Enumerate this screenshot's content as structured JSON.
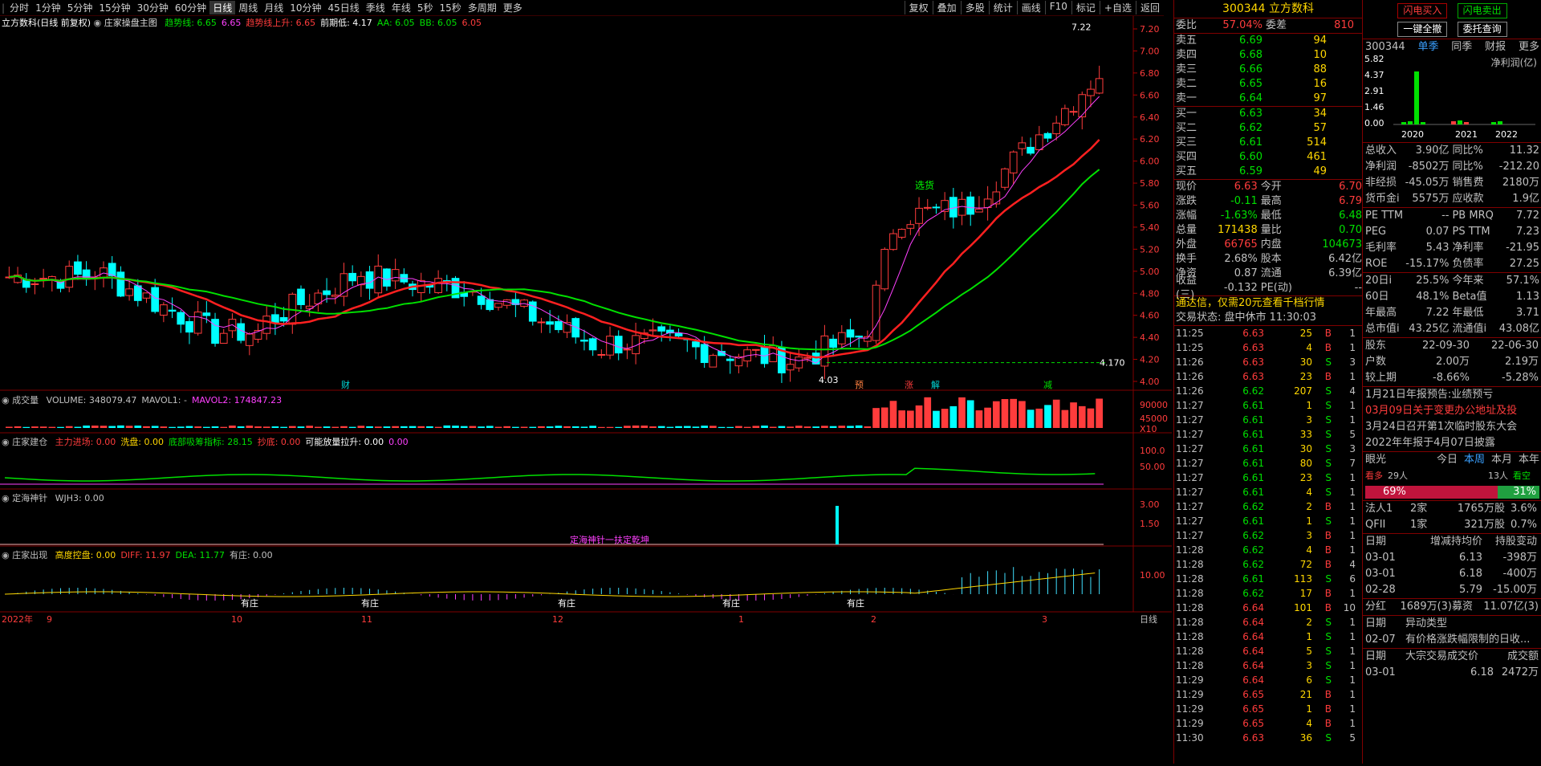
{
  "toolbar": {
    "periods": [
      "分时",
      "1分钟",
      "5分钟",
      "15分钟",
      "30分钟",
      "60分钟",
      "日线",
      "周线",
      "月线",
      "10分钟",
      "45日线",
      "季线",
      "年线",
      "5秒",
      "15秒",
      "多周期",
      "更多"
    ],
    "active": "日线",
    "right_buttons": [
      "复权",
      "叠加",
      "多股",
      "统计",
      "画线",
      "F10",
      "标记",
      "+自选",
      "返回"
    ]
  },
  "main_title": {
    "name": "立方数科(日线 前复权)",
    "indicator": "庄家操盘主图",
    "items": [
      {
        "t": "趋势线: 6.65",
        "c": "#00e000"
      },
      {
        "t": "6.65",
        "c": "#ff40ff"
      },
      {
        "t": "趋势线上升: 6.65",
        "c": "#ff3c3c"
      },
      {
        "t": "前期低: 4.17",
        "c": "#ffffff"
      },
      {
        "t": "AA: 6.05",
        "c": "#00e000"
      },
      {
        "t": "BB: 6.05",
        "c": "#00e000"
      },
      {
        "t": "6.05",
        "c": "#ff3c3c"
      }
    ]
  },
  "price_axis": [
    "7.20",
    "7.00",
    "6.80",
    "6.60",
    "6.40",
    "6.20",
    "6.00",
    "5.80",
    "5.60",
    "5.40",
    "5.20",
    "5.00",
    "4.80",
    "4.60",
    "4.40",
    "4.20",
    "4.00"
  ],
  "annotations": {
    "high": "7.22",
    "low": "4.03",
    "level": "4.170",
    "tag_xuanzhong": "选货",
    "markers": [
      "财",
      "预",
      "涨",
      "解",
      "减"
    ]
  },
  "volume_panel": {
    "title": "成交量",
    "items": [
      {
        "t": "VOLUME: 348079.47",
        "c": "#c0c0c0"
      },
      {
        "t": "MAVOL1: -",
        "c": "#c0c0c0"
      },
      {
        "t": "MAVOL2: 174847.23",
        "c": "#ff40ff"
      }
    ],
    "axis": [
      "90000",
      "45000",
      "X10"
    ]
  },
  "jiancang_panel": {
    "title": "庄家建仓",
    "items": [
      {
        "t": "主力进场: 0.00",
        "c": "#ff3c3c"
      },
      {
        "t": "洗盘: 0.00",
        "c": "#ffd700"
      },
      {
        "t": "底部吸筹指标: 28.15",
        "c": "#00e000"
      },
      {
        "t": "抄底: 0.00",
        "c": "#ff3c3c"
      },
      {
        "t": "可能放量拉升: 0.00",
        "c": "#ffffff"
      },
      {
        "t": "0.00",
        "c": "#ff40ff"
      }
    ],
    "axis": [
      "100.0",
      "50.00"
    ]
  },
  "dinghai_panel": {
    "title": "定海神针",
    "items": [
      {
        "t": "WJH3: 0.00",
        "c": "#c0c0c0"
      }
    ],
    "axis": [
      "3.00",
      "1.50"
    ],
    "caption": "定海神针一扶定乾坤"
  },
  "chuxian_panel": {
    "title": "庄家出现",
    "items": [
      {
        "t": "高度控盘: 0.00",
        "c": "#ffd700"
      },
      {
        "t": "DIFF: 11.97",
        "c": "#ff3c3c"
      },
      {
        "t": "DEA: 11.77",
        "c": "#00e000"
      },
      {
        "t": "有庄: 0.00",
        "c": "#c0c0c0"
      }
    ],
    "axis": [
      "10.00"
    ],
    "labels": [
      "有庄",
      "有庄",
      "有庄",
      "有庄",
      "有庄"
    ]
  },
  "date_axis": [
    "2022年",
    "9",
    "10",
    "11",
    "12",
    "1",
    "2",
    "3"
  ],
  "date_period": "日线",
  "quote": {
    "code": "300344",
    "name": "立方数科",
    "weibi_label": "委比",
    "weibi": "57.04%",
    "weicha_label": "委差",
    "weicha": "810",
    "asks": [
      {
        "l": "卖五",
        "p": "6.69",
        "v": "94"
      },
      {
        "l": "卖四",
        "p": "6.68",
        "v": "10"
      },
      {
        "l": "卖三",
        "p": "6.66",
        "v": "88"
      },
      {
        "l": "卖二",
        "p": "6.65",
        "v": "16"
      },
      {
        "l": "卖一",
        "p": "6.64",
        "v": "97"
      }
    ],
    "bids": [
      {
        "l": "买一",
        "p": "6.63",
        "v": "34"
      },
      {
        "l": "买二",
        "p": "6.62",
        "v": "57"
      },
      {
        "l": "买三",
        "p": "6.61",
        "v": "514"
      },
      {
        "l": "买四",
        "p": "6.60",
        "v": "461"
      },
      {
        "l": "买五",
        "p": "6.59",
        "v": "49"
      }
    ],
    "stats": [
      {
        "l1": "现价",
        "v1": "6.63",
        "c1": "#ff3c3c",
        "l2": "今开",
        "v2": "6.70",
        "c2": "#ff3c3c"
      },
      {
        "l1": "涨跌",
        "v1": "-0.11",
        "c1": "#00e000",
        "l2": "最高",
        "v2": "6.79",
        "c2": "#ff3c3c"
      },
      {
        "l1": "涨幅",
        "v1": "-1.63%",
        "c1": "#00e000",
        "l2": "最低",
        "v2": "6.48",
        "c2": "#00e000"
      },
      {
        "l1": "总量",
        "v1": "171438",
        "c1": "#ffd700",
        "l2": "量比",
        "v2": "0.70",
        "c2": "#00e000"
      },
      {
        "l1": "外盘",
        "v1": "66765",
        "c1": "#ff3c3c",
        "l2": "内盘",
        "v2": "104673",
        "c2": "#00e000"
      },
      {
        "l1": "换手",
        "v1": "2.68%",
        "c1": "#c0c0c0",
        "l2": "股本",
        "v2": "6.42亿",
        "c2": "#c0c0c0"
      },
      {
        "l1": "净资",
        "v1": "0.87",
        "c1": "#c0c0c0",
        "l2": "流通",
        "v2": "6.39亿",
        "c2": "#c0c0c0"
      },
      {
        "l1": "收益(三)",
        "v1": "-0.132",
        "c1": "#c0c0c0",
        "l2": "PE(动)",
        "v2": "--",
        "c2": "#c0c0c0"
      }
    ],
    "promo": "通达信，仅需20元查看千档行情",
    "trade_state": "交易状态: 盘中休市 11:30:03",
    "ticks": [
      [
        "11:25",
        "6.63",
        "25",
        "B",
        "1"
      ],
      [
        "11:25",
        "6.63",
        "4",
        "B",
        "1"
      ],
      [
        "11:26",
        "6.63",
        "30",
        "S",
        "3"
      ],
      [
        "11:26",
        "6.63",
        "23",
        "B",
        "1"
      ],
      [
        "11:26",
        "6.62",
        "207",
        "S",
        "4"
      ],
      [
        "11:27",
        "6.61",
        "1",
        "S",
        "1"
      ],
      [
        "11:27",
        "6.61",
        "3",
        "S",
        "1"
      ],
      [
        "11:27",
        "6.61",
        "33",
        "S",
        "5"
      ],
      [
        "11:27",
        "6.61",
        "30",
        "S",
        "3"
      ],
      [
        "11:27",
        "6.61",
        "80",
        "S",
        "7"
      ],
      [
        "11:27",
        "6.61",
        "23",
        "S",
        "1"
      ],
      [
        "11:27",
        "6.61",
        "4",
        "S",
        "1"
      ],
      [
        "11:27",
        "6.62",
        "2",
        "B",
        "1"
      ],
      [
        "11:27",
        "6.61",
        "1",
        "S",
        "1"
      ],
      [
        "11:27",
        "6.62",
        "3",
        "B",
        "1"
      ],
      [
        "11:28",
        "6.62",
        "4",
        "B",
        "1"
      ],
      [
        "11:28",
        "6.62",
        "72",
        "B",
        "4"
      ],
      [
        "11:28",
        "6.61",
        "113",
        "S",
        "6"
      ],
      [
        "11:28",
        "6.62",
        "17",
        "B",
        "1"
      ],
      [
        "11:28",
        "6.64",
        "101",
        "B",
        "10"
      ],
      [
        "11:28",
        "6.64",
        "2",
        "S",
        "1"
      ],
      [
        "11:28",
        "6.64",
        "1",
        "S",
        "1"
      ],
      [
        "11:28",
        "6.64",
        "5",
        "S",
        "1"
      ],
      [
        "11:28",
        "6.64",
        "3",
        "S",
        "1"
      ],
      [
        "11:29",
        "6.64",
        "6",
        "S",
        "1"
      ],
      [
        "11:29",
        "6.65",
        "21",
        "B",
        "1"
      ],
      [
        "11:29",
        "6.65",
        "1",
        "B",
        "1"
      ],
      [
        "11:29",
        "6.65",
        "4",
        "B",
        "1"
      ],
      [
        "11:30",
        "6.63",
        "36",
        "S",
        "5"
      ]
    ]
  },
  "fin": {
    "btn_flash_buy": "闪电买入",
    "btn_flash_sell": "闪电卖出",
    "btn_cancel_all": "一键全撤",
    "btn_entrust": "委托查询",
    "tabs": [
      "300344",
      "单季",
      "同季",
      "财报",
      "更多"
    ],
    "chart_title": "净利润(亿)",
    "chart_axis": [
      "5.82",
      "4.37",
      "2.91",
      "1.46",
      "0.00"
    ],
    "chart_years": [
      "2020",
      "2021",
      "2022"
    ],
    "rows1": [
      [
        "总收入",
        "3.90亿",
        "同比%",
        "11.32"
      ],
      [
        "净利润",
        "-8502万",
        "同比%",
        "-212.20"
      ],
      [
        "非经损",
        "-45.05万",
        "销售费",
        "2180万"
      ],
      [
        "货币金i",
        "5575万",
        "应收款",
        "1.9亿"
      ]
    ],
    "rows2": [
      [
        "PE TTM",
        "--",
        "PB MRQ",
        "7.72"
      ],
      [
        "PEG",
        "0.07",
        "PS TTM",
        "7.23"
      ],
      [
        "毛利率",
        "5.43",
        "净利率",
        "-21.95"
      ],
      [
        "ROE",
        "-15.17%",
        "负债率",
        "27.25"
      ]
    ],
    "rows3": [
      [
        "20日i",
        "25.5%",
        "今年来",
        "57.1%"
      ],
      [
        "60日",
        "48.1%",
        "Beta值",
        "1.13"
      ],
      [
        "年最高",
        "7.22",
        "年最低",
        "3.71"
      ],
      [
        "总市值i",
        "43.25亿",
        "流通值i",
        "43.08亿"
      ]
    ],
    "holders": [
      [
        "股东",
        "22-09-30",
        "22-06-30"
      ],
      [
        "户数",
        "2.00万",
        "2.19万"
      ],
      [
        "较上期",
        "-8.66%",
        "-5.28%"
      ]
    ],
    "news": [
      {
        "t": "1月21日年报预告:业绩预亏",
        "c": "#c0c0c0"
      },
      {
        "t": "03月09日关于变更办公地址及投",
        "c": "#ff3c3c"
      },
      {
        "t": "3月24日召开第1次临时股东大会",
        "c": "#c0c0c0"
      },
      {
        "t": "2022年年报于4月07日披露",
        "c": "#c0c0c0"
      }
    ],
    "yanguang": {
      "label": "眼光",
      "tabs": [
        "今日",
        "本周",
        "本月",
        "本年"
      ],
      "bull": "看多",
      "bull_n": "29人",
      "bear_n": "13人",
      "bear": "看空",
      "bull_pct": "69%",
      "bear_pct": "31%"
    },
    "inst": [
      [
        "法人1",
        "2家",
        "1765万股",
        "3.6%"
      ],
      [
        "QFII",
        "1家",
        "321万股",
        "0.7%"
      ]
    ],
    "inst_head": [
      "日期",
      "增减持均价",
      "持股变动"
    ],
    "inst_rows": [
      [
        "03-01",
        "6.13",
        "-398万"
      ],
      [
        "03-01",
        "6.18",
        "-400万"
      ],
      [
        "02-28",
        "5.79",
        "-15.00万"
      ]
    ],
    "fenhong": [
      "分红",
      "1689万(3)",
      "募资",
      "11.07亿(3)"
    ],
    "yidong_head": [
      "日期",
      "异动类型"
    ],
    "yidong": [
      "02-07",
      "有价格涨跌幅限制的日收..."
    ],
    "dazong_head": [
      "日期",
      "大宗交易成交价",
      "成交额"
    ],
    "dazong": [
      "03-01",
      "6.18",
      "2472万"
    ]
  }
}
